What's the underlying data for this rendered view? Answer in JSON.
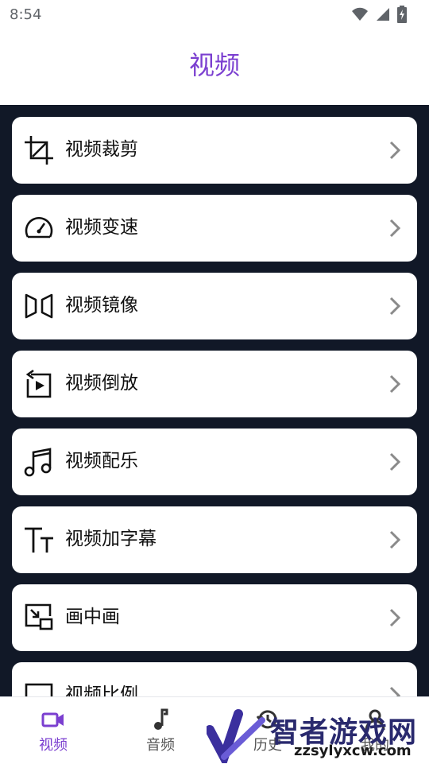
{
  "status_bar": {
    "time": "8:54"
  },
  "header": {
    "title": "视频"
  },
  "menu": {
    "items": [
      {
        "label": "视频裁剪",
        "icon": "crop-icon"
      },
      {
        "label": "视频变速",
        "icon": "speedometer-icon"
      },
      {
        "label": "视频镜像",
        "icon": "mirror-icon"
      },
      {
        "label": "视频倒放",
        "icon": "reverse-play-icon"
      },
      {
        "label": "视频配乐",
        "icon": "music-note-icon"
      },
      {
        "label": "视频加字幕",
        "icon": "text-size-icon"
      },
      {
        "label": "画中画",
        "icon": "picture-in-picture-icon"
      },
      {
        "label": "视频比例",
        "icon": "aspect-ratio-icon"
      }
    ]
  },
  "bottom_nav": {
    "items": [
      {
        "label": "视频",
        "icon": "video-camera-icon",
        "active": true
      },
      {
        "label": "音频",
        "icon": "music-note-icon",
        "active": false
      },
      {
        "label": "历史",
        "icon": "history-icon",
        "active": false
      },
      {
        "label": "我的",
        "icon": "user-icon",
        "active": false
      }
    ]
  },
  "watermark": {
    "brand": "智者游戏网",
    "url": "zzsylyxcw.com"
  },
  "colors": {
    "accent": "#7b3fd0",
    "background": "#111827",
    "card": "#ffffff",
    "chevron": "#8a8a8a"
  }
}
